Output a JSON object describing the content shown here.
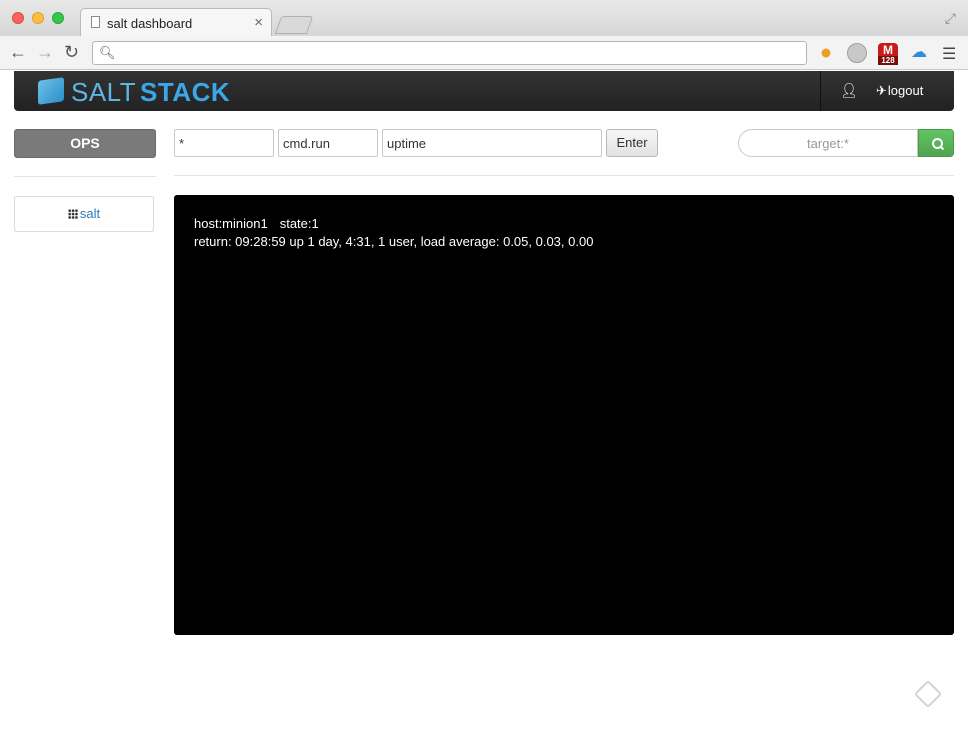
{
  "browser": {
    "tab_title": "salt dashboard",
    "tab_close": "×",
    "omnibox_value": "",
    "extensions": {
      "gmail_letter": "M",
      "gmail_count": "128"
    }
  },
  "navbar": {
    "brand_salt": "SALT",
    "brand_stack": "STACK",
    "user_icon": "user-icon",
    "logout_label": "logout"
  },
  "sidebar": {
    "ops_label": "OPS",
    "items": [
      {
        "label": "salt",
        "icon": "grid-icon"
      }
    ]
  },
  "command": {
    "target_value": "*",
    "function_value": "cmd.run",
    "args_value": "uptime",
    "enter_label": "Enter"
  },
  "search": {
    "placeholder": "target:*"
  },
  "output": {
    "host_label": "host:minion1",
    "state_label": "state:1",
    "return_line": "return: 09:28:59 up 1 day, 4:31, 1 user, load average: 0.05, 0.03, 0.00"
  },
  "colors": {
    "navbar": "#2a2a2a",
    "brand_blue": "#3aa7e8",
    "ops_button": "#7a7a7a",
    "search_button": "#5bb75b",
    "console_bg": "#000000"
  }
}
